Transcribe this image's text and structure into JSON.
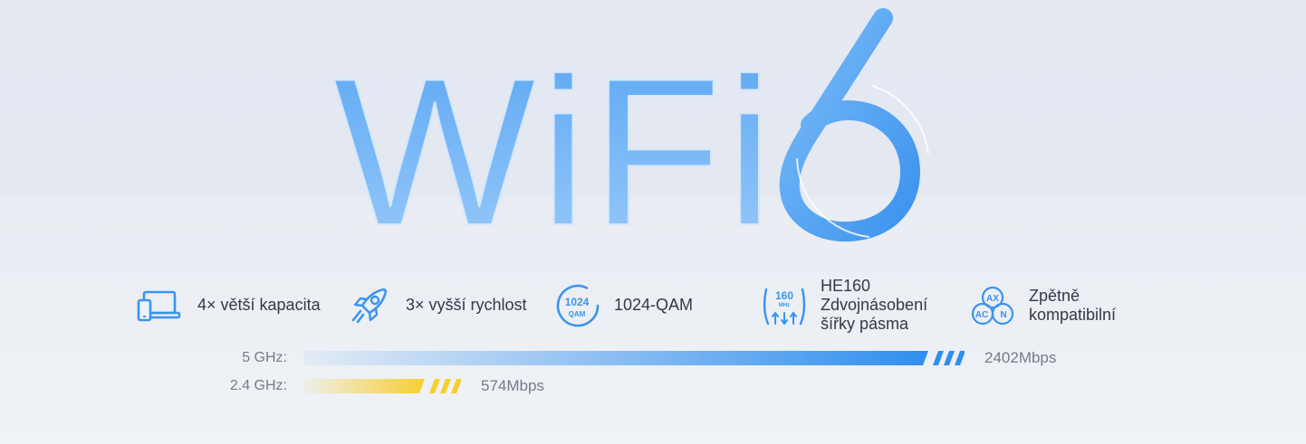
{
  "hero": {
    "title_text": "WiFi",
    "title_number": "6"
  },
  "features": [
    {
      "icon": "laptop-phone-icon",
      "lines": [
        "4× větší kapacita"
      ]
    },
    {
      "icon": "rocket-icon",
      "lines": [
        "3× vyšší rychlost"
      ]
    },
    {
      "icon": "qam-badge-icon",
      "icon_text": [
        "1024",
        "QAM"
      ],
      "lines": [
        "1024-QAM"
      ]
    },
    {
      "icon": "he160-icon",
      "icon_text": [
        "160",
        "MHz"
      ],
      "lines": [
        "HE160",
        "Zdvojnásobení",
        "šířky pásma"
      ]
    },
    {
      "icon": "compatibility-icon",
      "icon_text": [
        "AX",
        "AC",
        "N"
      ],
      "lines": [
        "Zpětně",
        "kompatibilní"
      ]
    }
  ],
  "speeds": [
    {
      "band": "5 GHz:",
      "value": "2402Mbps",
      "mbps": 2402,
      "color": "#2f8ff0"
    },
    {
      "band": "2.4 GHz:",
      "value": "574Mbps",
      "mbps": 574,
      "color": "#f6cf2e"
    }
  ],
  "colors": {
    "accent_blue": "#3b93f0",
    "wifi_text": "#7fbcf7",
    "text": "#333a44",
    "muted": "#767c86"
  }
}
